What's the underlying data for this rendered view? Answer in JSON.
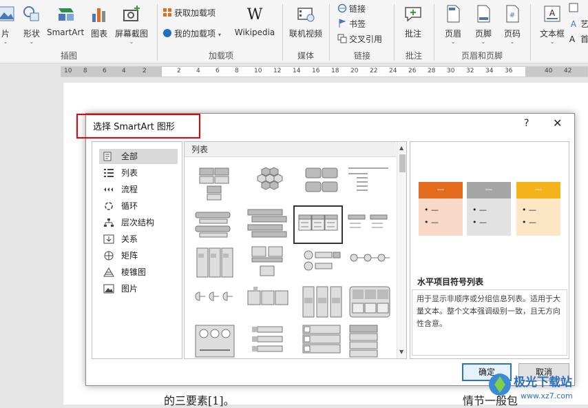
{
  "ribbon": {
    "buttons": [
      {
        "label": "片",
        "icon": "picture-icon"
      },
      {
        "label": "形状",
        "icon": "shapes-icon"
      },
      {
        "label": "SmartArt",
        "icon": "smartart-icon"
      },
      {
        "label": "图表",
        "icon": "chart-icon"
      },
      {
        "label": "屏幕截图",
        "icon": "screenshot-icon"
      },
      {
        "label": "Wikipedia",
        "icon": "wikipedia-icon"
      },
      {
        "label": "联机视频",
        "icon": "online-video-icon"
      },
      {
        "label": "批注",
        "icon": "comment-icon"
      },
      {
        "label": "页眉",
        "icon": "header-icon"
      },
      {
        "label": "页脚",
        "icon": "footer-icon"
      },
      {
        "label": "页码",
        "icon": "page-number-icon"
      },
      {
        "label": "文本框",
        "icon": "textbox-icon"
      }
    ],
    "small": {
      "get_addins": "获取加载项",
      "my_addins": "我的加载项",
      "link": "链接",
      "bookmark": "书签",
      "cross_ref": "交叉引用",
      "side1": "艺",
      "side2": "首"
    },
    "groups": {
      "illustrations": "插图",
      "addins": "加载项",
      "media": "媒体",
      "links": "链接",
      "comments": "批注",
      "header_footer": "页眉和页脚"
    }
  },
  "ruler": {
    "ticks": [
      "10",
      "8",
      "6",
      "4",
      "2",
      "2",
      "4",
      "6",
      "8",
      "10",
      "12",
      "14",
      "16",
      "18",
      "20",
      "22",
      "24",
      "26",
      "28",
      "30",
      "32",
      "34",
      "36",
      "40",
      "42"
    ]
  },
  "document": {
    "text_left": "的三要素[1]。",
    "text_right": "情节一般包"
  },
  "dialog": {
    "title": "选择 SmartArt 图形",
    "help": "?",
    "close": "✕",
    "categories": [
      {
        "label": "全部",
        "icon": "all-icon"
      },
      {
        "label": "列表",
        "icon": "list-icon"
      },
      {
        "label": "流程",
        "icon": "process-icon"
      },
      {
        "label": "循环",
        "icon": "cycle-icon"
      },
      {
        "label": "层次结构",
        "icon": "hierarchy-icon"
      },
      {
        "label": "关系",
        "icon": "relationship-icon"
      },
      {
        "label": "矩阵",
        "icon": "matrix-icon"
      },
      {
        "label": "棱锥图",
        "icon": "pyramid-icon"
      },
      {
        "label": "图片",
        "icon": "picture-icon"
      }
    ],
    "selected_category": "全部",
    "gallery_header": "列表",
    "preview": {
      "col_label": "—",
      "bullet": "•  —",
      "colors": [
        "#e46c1f",
        "#a5a5a5",
        "#f5b31a"
      ],
      "body_colors": [
        "#f8d9c8",
        "#e2e2e2",
        "#fde6c4"
      ],
      "title": "水平项目符号列表",
      "description": "用于显示非顺序或分组信息列表。适用于大量文本。整个文本强调级别一致，且无方向性含意。"
    },
    "ok": "确定",
    "cancel": "取消"
  },
  "watermark": {
    "text": "极光下载站",
    "url": "www.xz7.com"
  }
}
